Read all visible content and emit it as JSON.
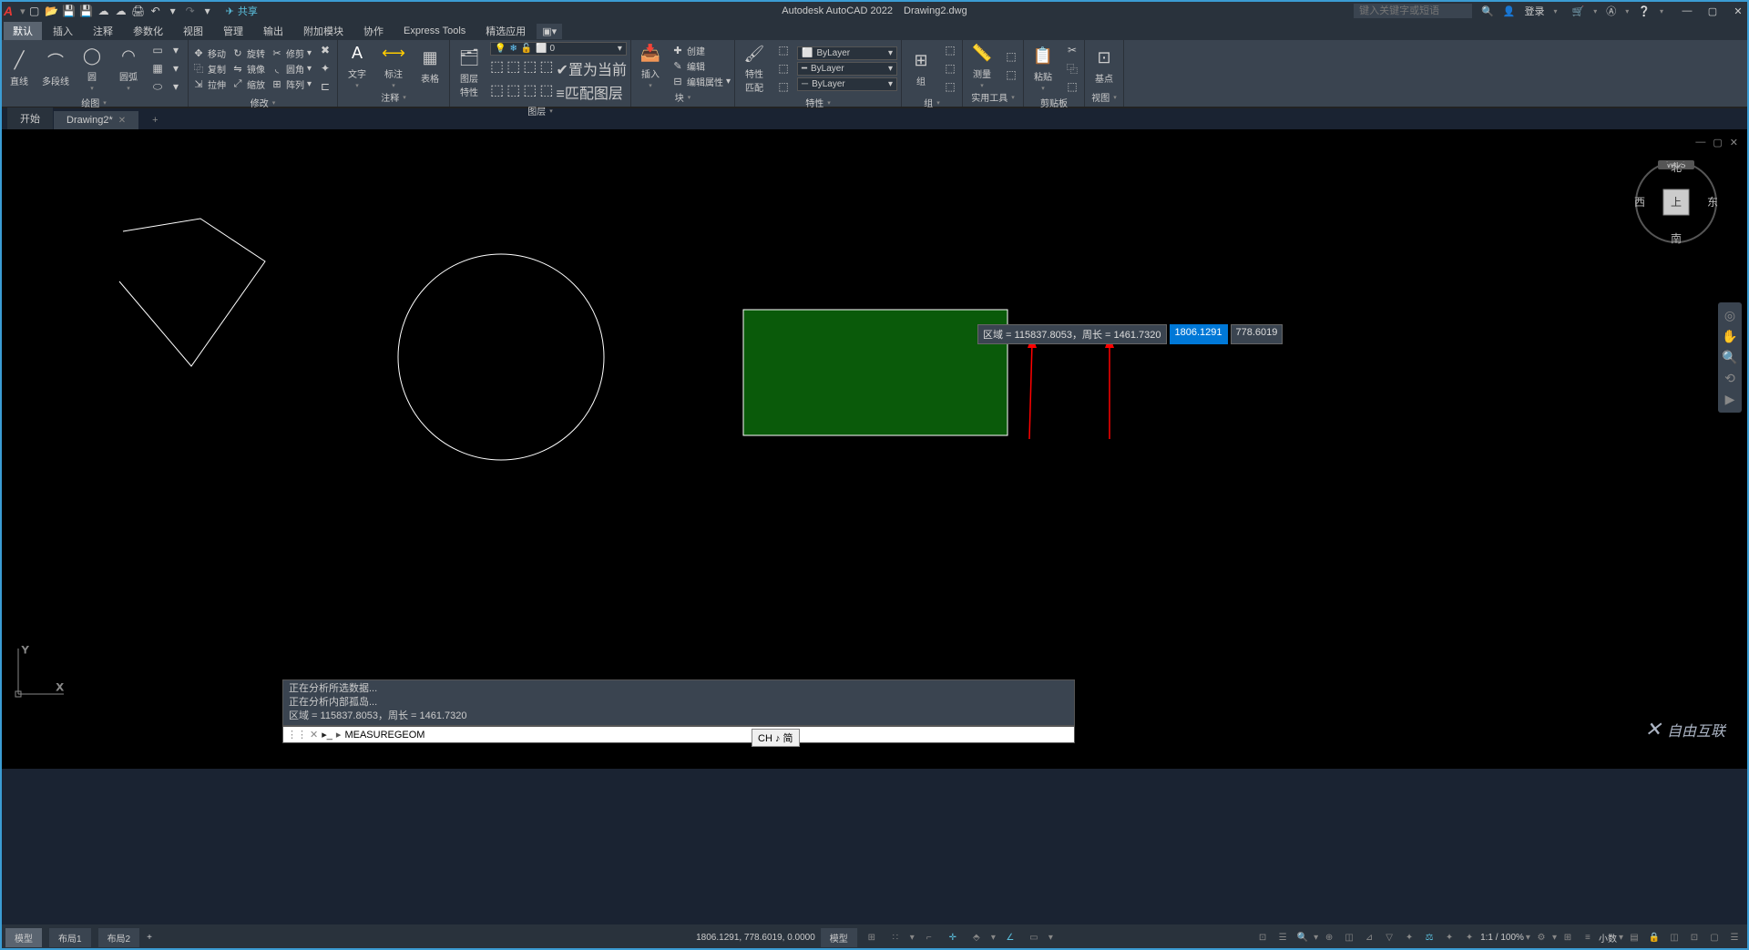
{
  "app": {
    "name": "Autodesk AutoCAD 2022",
    "file": "Drawing2.dwg"
  },
  "share": "共享",
  "search_placeholder": "键入关键字或短语",
  "login": "登录",
  "menu": {
    "items": [
      "默认",
      "插入",
      "注释",
      "参数化",
      "视图",
      "管理",
      "输出",
      "附加模块",
      "协作",
      "Express Tools",
      "精选应用"
    ]
  },
  "ribbon": {
    "draw": {
      "title": "绘图",
      "line": "直线",
      "polyline": "多段线",
      "circle": "圆",
      "arc": "圆弧"
    },
    "modify": {
      "title": "修改",
      "move": "移动",
      "copy": "复制",
      "stretch": "拉伸",
      "rotate": "旋转",
      "mirror": "镜像",
      "scale": "缩放",
      "trim": "修剪",
      "fillet": "圆角",
      "array": "阵列"
    },
    "annot": {
      "title": "注释",
      "text": "文字",
      "dim": "标注",
      "table": "表格"
    },
    "layers": {
      "title": "图层",
      "props": "图层\n特性",
      "current": "置为当前",
      "match": "匹配图层"
    },
    "block": {
      "title": "块",
      "insert": "插入",
      "create": "创建",
      "edit": "编辑",
      "editattr": "编辑属性"
    },
    "prop": {
      "title": "特性",
      "match": "特性\n匹配",
      "bylayer": "ByLayer"
    },
    "group": {
      "title": "组",
      "g": "组"
    },
    "util": {
      "title": "实用工具",
      "measure": "测量"
    },
    "clip": {
      "title": "剪贴板",
      "paste": "粘贴"
    },
    "view": {
      "title": "视图",
      "base": "基点"
    }
  },
  "tabs": {
    "start": "开始",
    "drawing": "Drawing2*"
  },
  "viewcube": {
    "n": "北",
    "s": "南",
    "e": "东",
    "w": "西",
    "top": "上",
    "wcs": "WCS"
  },
  "tooltip": {
    "area_label": "区域 = 115837.8053，周长 = 1461.7320",
    "coord1": "1806.1291",
    "coord2": "778.6019"
  },
  "cmd": {
    "hist1": "正在分析所选数据...",
    "hist2": "正在分析内部孤岛...",
    "hist3": "区域 = 115837.8053，周长 = 1461.7320",
    "current": "MEASUREGEOM"
  },
  "ime": "CH ♪ 简",
  "status": {
    "model": "模型",
    "layout1": "布局1",
    "layout2": "布局2",
    "coords": "1806.1291, 778.6019, 0.0000",
    "model_btn": "模型",
    "scale": "1:1 / 100%",
    "decimal": "小数"
  },
  "watermark": "自由互联"
}
